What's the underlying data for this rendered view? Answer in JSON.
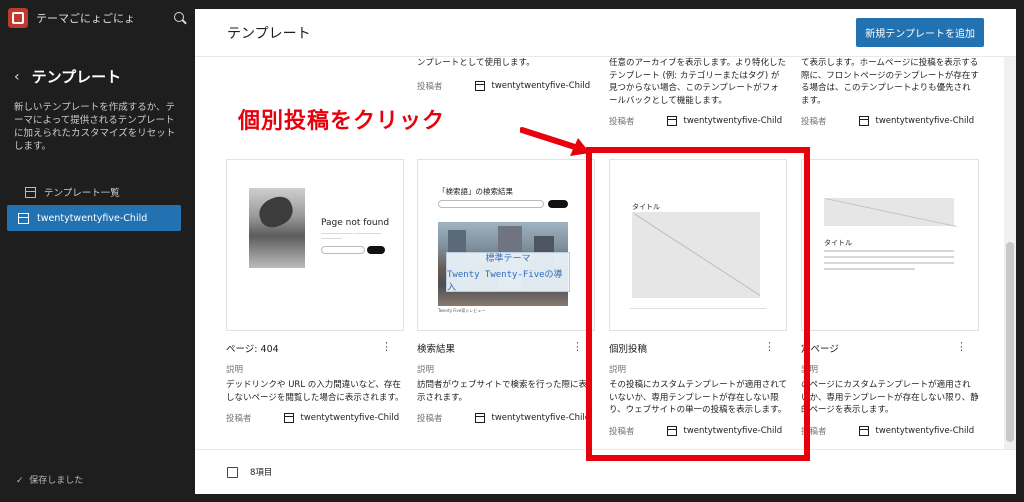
{
  "site": {
    "name": "テーマごにょごにょ"
  },
  "sidebar": {
    "back_icon": "chevron-left-icon",
    "title": "テンプレート",
    "description": "新しいテンプレートを作成するか、テーマによって提供されるテンプレートに加えられたカスタマイズをリセットします。",
    "items": [
      {
        "label": "テンプレート一覧",
        "active": false
      },
      {
        "label": "twentytwentyfive-Child",
        "active": true
      }
    ],
    "saved_label": "保存しました"
  },
  "header": {
    "title": "テンプレート",
    "add_button": "新規テンプレートを追加"
  },
  "top_row": {
    "cards": [
      {
        "desc_tail": "ンプレートとして使用します。",
        "author_label": "投稿者",
        "author": "twentytwentyfive-Child"
      },
      {
        "desc_tail": "任意のアーカイブを表示します。より特化したテンプレート (例: カテゴリーまたはタグ) が見つからない場合、このテンプレートがフォールバックとして機能します。",
        "author_label": "投稿者",
        "author": "twentytwentyfive-Child"
      },
      {
        "desc_tail": "て表示します。ホームページに投稿を表示する際に、フロントページのテンプレートが存在する場合は、このテンプレートよりも優先されます。",
        "author_label": "投稿者",
        "author": "twentytwentyfive-Child"
      }
    ]
  },
  "cards": [
    {
      "title": "ページ: 404",
      "desc_label": "説明",
      "desc": "デッドリンクや URL の入力間違いなど、存在しないページを閲覧した場合に表示されます。",
      "author_label": "投稿者",
      "author": "twentytwentyfive-Child",
      "preview": {
        "page_not_found": "Page not found"
      }
    },
    {
      "title": "検索結果",
      "desc_label": "説明",
      "desc": "訪問者がウェブサイトで検索を行った際に表示されます。",
      "author_label": "投稿者",
      "author": "twentytwentyfive-Child",
      "preview": {
        "heading": "「検索語」の検索結果",
        "sign_line1": "標準テーマ",
        "sign_line2": "Twenty Twenty-Fiveの導入",
        "caption": "Twenty Five導入レビュー"
      }
    },
    {
      "title": "個別投稿",
      "desc_label": "説明",
      "desc": "その投稿にカスタムテンプレートが適用されていないか、専用テンプレートが存在しない限り、ウェブサイトの単一の投稿を表示します。",
      "author_label": "投稿者",
      "author": "twentytwentyfive-Child",
      "preview": {
        "label": "タイトル"
      }
    },
    {
      "title": "定ページ",
      "desc_label": "説明",
      "desc": "のページにカスタムテンプレートが適用されいか、専用テンプレートが存在しない限り、静的ページを表示します。",
      "author_label": "投稿者",
      "author": "twentytwentyfive-Child",
      "preview": {
        "label": "タイトル"
      }
    }
  ],
  "footer": {
    "count": "8項目"
  },
  "annotation": {
    "text": "個別投稿をクリック",
    "color": "#e8000c"
  },
  "colors": {
    "accent": "#2271b1",
    "sidebar_bg": "#1e1e1e"
  }
}
